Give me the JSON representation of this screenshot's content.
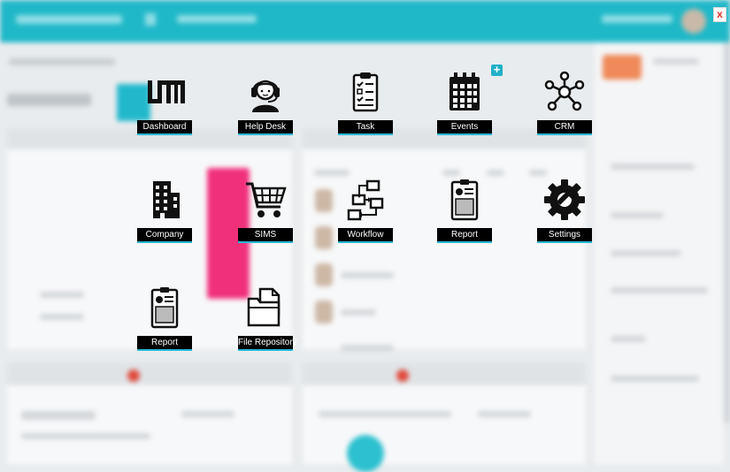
{
  "launcher": {
    "close_label": "x",
    "add_label": "+",
    "apps": [
      {
        "label": "Dashboard",
        "icon": "dashboard-logo-icon"
      },
      {
        "label": "Help Desk",
        "icon": "headset-agent-icon"
      },
      {
        "label": "Task",
        "icon": "clipboard-checklist-icon"
      },
      {
        "label": "Events",
        "icon": "calendar-icon"
      },
      {
        "label": "CRM",
        "icon": "network-nodes-icon"
      },
      {
        "label": "Company",
        "icon": "building-icon"
      },
      {
        "label": "SIMS",
        "icon": "shopping-cart-icon"
      },
      {
        "label": "Workflow",
        "icon": "workflow-icon"
      },
      {
        "label": "Report",
        "icon": "report-clipboard-icon"
      },
      {
        "label": "Settings",
        "icon": "gear-wrench-icon"
      },
      {
        "label": "Report",
        "icon": "report-clipboard-icon"
      },
      {
        "label": "File Repository",
        "icon": "folder-file-icon"
      }
    ]
  },
  "colors": {
    "accent": "#29b6d6",
    "topbar": "#1fb8c8",
    "close": "#e0302c"
  }
}
